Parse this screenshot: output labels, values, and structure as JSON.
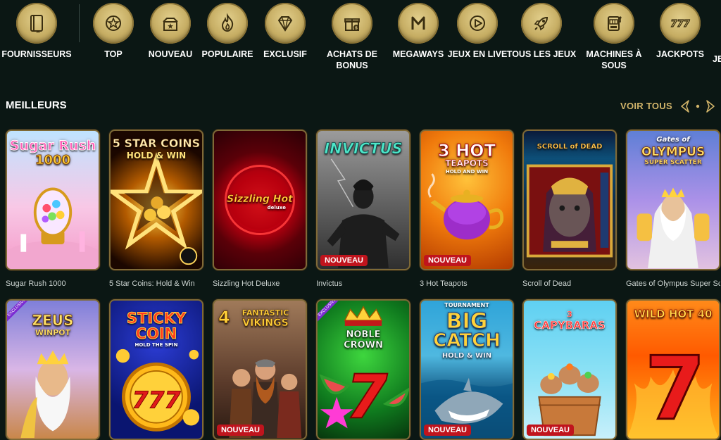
{
  "categories": [
    {
      "label": "FOURNISSEURS",
      "icon": "book-icon"
    },
    {
      "label": "TOP",
      "icon": "star-badge-icon"
    },
    {
      "label": "NOUVEAU",
      "icon": "gift-box-icon"
    },
    {
      "label": "POPULAIRE",
      "icon": "flame-icon"
    },
    {
      "label": "EXCLUSIF",
      "icon": "diamond-icon"
    },
    {
      "label": "ACHATS DE",
      "label2": "BONUS",
      "icon": "bonus-gift-icon"
    },
    {
      "label": "MEGAWAYS",
      "icon": "megaways-m-icon"
    },
    {
      "label": "JEUX EN LIVE",
      "icon": "play-icon"
    },
    {
      "label": "TOUS LES JEUX",
      "icon": "rocket-icon"
    },
    {
      "label": "MACHINES À",
      "label2": "SOUS",
      "icon": "slot-machine-icon"
    },
    {
      "label": "JACKPOTS",
      "icon": "triple-seven-icon"
    },
    {
      "label": "JE",
      "icon": "partial-icon"
    }
  ],
  "section": {
    "title": "MEILLEURS",
    "see_all": "VOIR TOUS"
  },
  "badges": {
    "new": "NOUVEAU",
    "exclusive": "EXCLUSIVE"
  },
  "games_row1": [
    {
      "name": "Sugar Rush 1000",
      "art_title": "Sugar Rush",
      "art_sub": "1000",
      "badge": ""
    },
    {
      "name": "5 Star Coins: Hold & Win",
      "art_title": "5 STAR COINS",
      "art_sub": "HOLD & WIN",
      "badge": ""
    },
    {
      "name": "Sizzling Hot Deluxe",
      "art_title": "Sizzling Hot",
      "art_sub": "deluxe",
      "badge": ""
    },
    {
      "name": "Invictus",
      "art_title": "INVICTUS",
      "art_sub": "",
      "badge": "NOUVEAU"
    },
    {
      "name": "3 Hot Teapots",
      "art_title": "3 HOT",
      "art_sub": "TEAPOTS",
      "art_sub2": "HOLD AND WIN",
      "badge": "NOUVEAU"
    },
    {
      "name": "Scroll of Dead",
      "art_title": "SCROLL of DEAD",
      "art_sub": "",
      "badge": ""
    },
    {
      "name": "Gates of Olympus Super Scatter",
      "art_title": "OLYMPUS",
      "art_sub": "SUPER SCATTER",
      "art_top": "Gates of",
      "badge": ""
    }
  ],
  "games_row2": [
    {
      "art_title": "ZEUS",
      "art_sub": "WINPOT",
      "badge": "",
      "exclusive": true
    },
    {
      "art_title": "STICKY",
      "art_sub": "COIN",
      "art_sub2": "HOLD THE SPIN",
      "badge": ""
    },
    {
      "art_title": "FANTASTIC",
      "art_sub": "VIKINGS",
      "art_top": "4",
      "badge": "NOUVEAU"
    },
    {
      "art_title": "NOBLE",
      "art_sub": "CROWN",
      "badge": "",
      "exclusive": true
    },
    {
      "art_title": "BIG",
      "art_sub": "CATCH",
      "art_top": "TOURNAMENT",
      "art_sub2": "HOLD & WIN",
      "badge": "NOUVEAU"
    },
    {
      "art_title": "CAPYBARAS",
      "art_top": "3",
      "badge": "NOUVEAU"
    },
    {
      "art_title": "WILD HOT 40",
      "badge": ""
    }
  ],
  "colors": {
    "background": "#0b1714",
    "gold": "#d2b56a",
    "badge_red": "#c0141d"
  }
}
